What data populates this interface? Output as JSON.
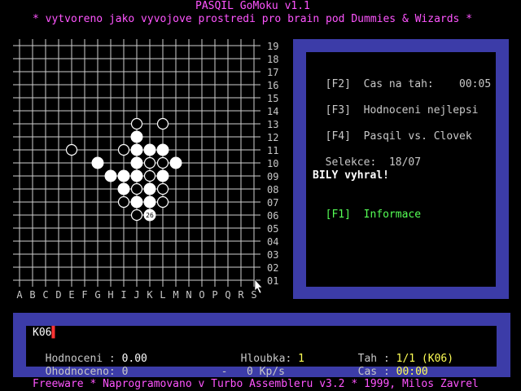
{
  "header": {
    "title": "PASQIL GoMoku v1.1",
    "subtitle": "* vytvoreno jako vyvojove prostredi pro brain pod Dummies & Wizards *"
  },
  "board": {
    "columns": [
      "A",
      "B",
      "C",
      "D",
      "E",
      "F",
      "G",
      "H",
      "I",
      "J",
      "K",
      "L",
      "M",
      "N",
      "O",
      "P",
      "Q",
      "R",
      "S"
    ],
    "rows": [
      "19",
      "18",
      "17",
      "16",
      "15",
      "14",
      "13",
      "12",
      "11",
      "10",
      "09",
      "08",
      "07",
      "06",
      "05",
      "04",
      "03",
      "02",
      "01"
    ],
    "white_stones": [
      "J12",
      "J11",
      "K11",
      "L11",
      "G10",
      "J10",
      "M10",
      "H09",
      "I09",
      "J09",
      "L09",
      "I08",
      "K08",
      "J07",
      "K07",
      "K06"
    ],
    "black_stones": [
      "J13",
      "L13",
      "E11",
      "I11",
      "K10",
      "L10",
      "K09",
      "J08",
      "L08",
      "I07",
      "L07",
      "J06"
    ],
    "last_move": {
      "pos": "K06",
      "label": "26"
    }
  },
  "panel": {
    "cas_key": "[F2]",
    "cas_label": "Cas na tah:",
    "cas_value": "00:05",
    "hodn_key": "[F3]",
    "hodn_label": "Hodnoceni nejlepsi",
    "pasqil_key": "[F4]",
    "pasqil_label": "Pasqil vs. Clovek",
    "selekce_label": "Selekce:",
    "selekce_value": "18/07",
    "winner": "BILY vyhral!",
    "info_key": "[F1]",
    "info_label": "Informace"
  },
  "status": {
    "move": "K06",
    "hodnoceni_label": "Hodnoceni :",
    "hodnoceni_value": "0.00",
    "ohodnoceno_label": "Ohodnoceno:",
    "ohodnoceno_value": "0",
    "hloubka_label": "Hloubka:",
    "hloubka_value": "1",
    "speed_dash": "-",
    "speed_value": "0 Kp/s",
    "tah_label": "Tah :",
    "tah_value": "1/1 (K06)",
    "cas_label": "Cas :",
    "cas_value": "00:00"
  },
  "footer": {
    "text": "Freeware * Naprogramovano v Turbo Assembleru v3.2 * 1999, Milos Zavrel"
  }
}
